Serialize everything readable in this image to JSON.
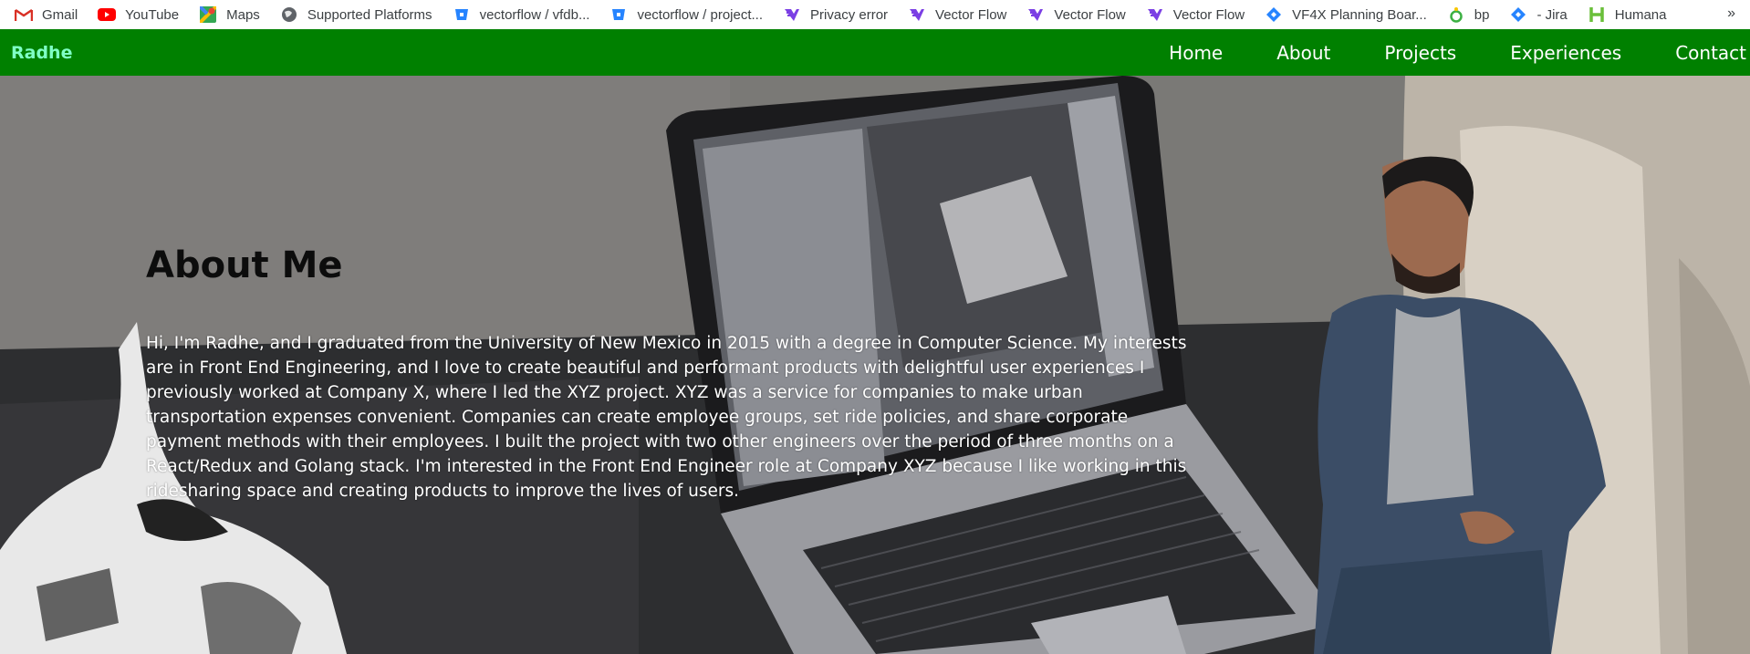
{
  "bookmarks": [
    {
      "label": "Gmail",
      "icon": "gmail-icon"
    },
    {
      "label": "YouTube",
      "icon": "youtube-icon"
    },
    {
      "label": "Maps",
      "icon": "maps-icon"
    },
    {
      "label": "Supported Platforms",
      "icon": "globe-icon"
    },
    {
      "label": "vectorflow / vfdb...",
      "icon": "bitbucket-icon"
    },
    {
      "label": "vectorflow / project...",
      "icon": "bitbucket-icon"
    },
    {
      "label": "Privacy error",
      "icon": "vectorflow-icon"
    },
    {
      "label": "Vector Flow",
      "icon": "vectorflow-icon"
    },
    {
      "label": "Vector Flow",
      "icon": "vectorflow-icon"
    },
    {
      "label": "Vector Flow",
      "icon": "vectorflow-icon"
    },
    {
      "label": "VF4X Planning Boar...",
      "icon": "jira-icon"
    },
    {
      "label": "bp",
      "icon": "bp-icon"
    },
    {
      "label": "- Jira",
      "icon": "jira-icon"
    },
    {
      "label": "Humana",
      "icon": "humana-icon"
    }
  ],
  "more_label": "»",
  "navbar": {
    "brand": "Radhe",
    "links": [
      "Home",
      "About",
      "Projects",
      "Experiences",
      "Contact"
    ]
  },
  "about": {
    "title": "About Me",
    "body": "Hi, I'm Radhe, and I graduated from the University of New Mexico in 2015 with a degree in Computer Science. My interests are in Front End Engineering, and I love to create beautiful and performant products with delightful user experiences I previously worked at Company X, where I led the XYZ project. XYZ was a service for companies to make urban transportation expenses convenient. Companies can create employee groups, set ride policies, and share corporate payment methods with their employees. I built the project with two other engineers over the period of three months on a React/Redux and Golang stack. I'm interested in the Front End Engineer role at Company XYZ because I like working in this ridesharing space and creating products to improve the lives of users."
  },
  "colors": {
    "navbar_bg": "#008000",
    "brand": "#7fffc6",
    "nav_text": "#ffffff",
    "title": "#0c0c0c",
    "body_text": "#ffffff"
  }
}
